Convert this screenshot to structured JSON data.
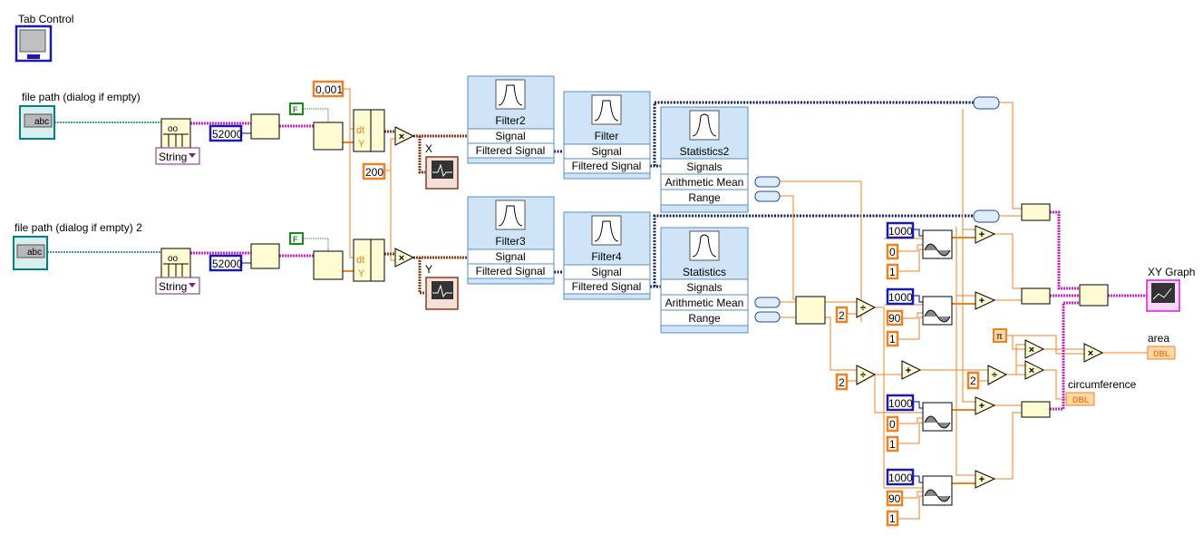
{
  "colors": {
    "numeric_wire": "#f08020",
    "integer_wire": "#0000a0",
    "array_wire": "#d020d0",
    "path_wire": "#008080",
    "waveform_wire": "#8b3a1a",
    "boolean": "#1a8a1a"
  },
  "labels": {
    "tab_control": "Tab Control",
    "file_path_1": "file path (dialog if empty)",
    "file_path_2": "file path (dialog if empty) 2",
    "graph_x": "X",
    "graph_y": "Y",
    "xy_graph": "XY Graph",
    "area": "area",
    "circumference": "circumference"
  },
  "dropdowns": {
    "format_1": "String",
    "format_2": "String"
  },
  "constants": {
    "rows_1": "52000",
    "rows_2": "52000",
    "bool_1": "F",
    "bool_2": "F",
    "dt": "0,001",
    "gain": "200",
    "sine": [
      {
        "samples": "1000",
        "phase": "0",
        "cycles": "1"
      },
      {
        "samples": "1000",
        "phase": "90",
        "cycles": "1"
      },
      {
        "samples": "1000",
        "phase": "0",
        "cycles": "1"
      },
      {
        "samples": "1000",
        "phase": "90",
        "cycles": "1"
      }
    ],
    "div_a": "2",
    "div_b": "2",
    "div_c": "2",
    "pi": "π"
  },
  "indicators": {
    "type": "DBL",
    "dt_term": "dt",
    "y_term": "Y"
  },
  "express_vis": [
    {
      "name": "Filter2",
      "rows": [
        "Signal",
        "Filtered Signal"
      ]
    },
    {
      "name": "Filter",
      "rows": [
        "Signal",
        "Filtered Signal"
      ]
    },
    {
      "name": "Statistics2",
      "rows": [
        "Signals",
        "Arithmetic Mean",
        "Range"
      ]
    },
    {
      "name": "Filter3",
      "rows": [
        "Signal",
        "Filtered Signal"
      ]
    },
    {
      "name": "Filter4",
      "rows": [
        "Signal",
        "Filtered Signal"
      ]
    },
    {
      "name": "Statistics",
      "rows": [
        "Signals",
        "Arithmetic Mean",
        "Range"
      ]
    }
  ],
  "operators": {
    "multiply": "×",
    "add": "+",
    "divide": "÷"
  }
}
